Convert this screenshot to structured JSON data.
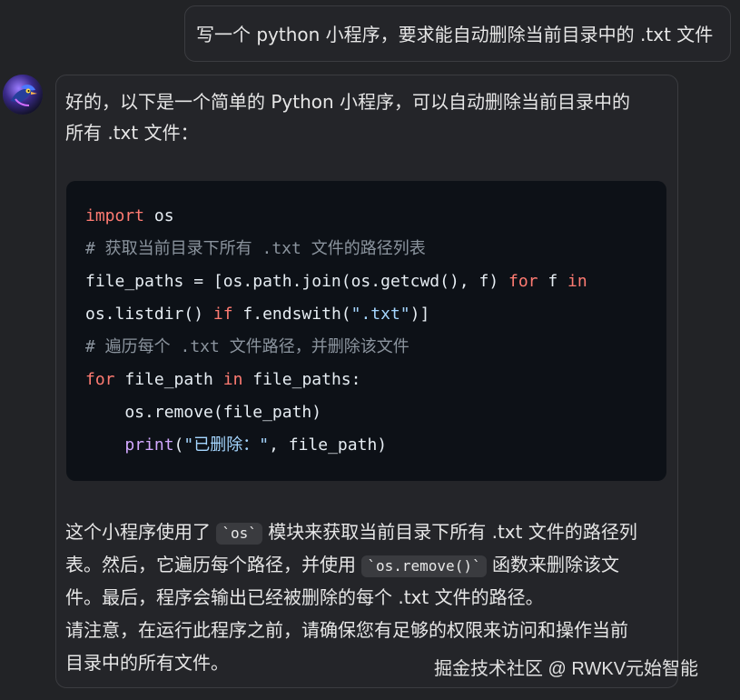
{
  "user_message": {
    "text": "写一个 python 小程序，要求能自动删除当前目录中的 .txt 文件"
  },
  "assistant_message": {
    "intro_line1": "好的，以下是一个简单的 Python 小程序，可以自动删除当前目录中的",
    "intro_line2": "所有 .txt 文件：",
    "code_lines": {
      "import_kw": "import",
      "import_rest": " os",
      "comment1": "# 获取当前目录下所有 .txt 文件的路径列表",
      "line3_prefix": "file_paths = [os.path.join(os.getcwd(), f) ",
      "line3_for": "for",
      "line3_mid": " f ",
      "line3_in": "in",
      "line4_prefix": "os.listdir() ",
      "line4_if": "if",
      "line4_mid": " f.endswith(",
      "line4_str": "\".txt\"",
      "line4_end": ")]",
      "comment2": "# 遍历每个 .txt 文件路径，并删除该文件",
      "line6_for": "for",
      "line6_mid": " file_path ",
      "line6_in": "in",
      "line6_end": " file_paths:",
      "line7": "    os.remove(file_path)",
      "line8_indent": "    ",
      "line8_print": "print",
      "line8_open": "(",
      "line8_str": "\"已删除：\"",
      "line8_end": ", file_path)"
    },
    "explain": {
      "row1_a": "这个小程序使用了 ",
      "row1_code": "`os`",
      "row1_b": " 模块来获取当前目录下所有 .txt 文件的路径列",
      "row2_a": "表。然后，它遍历每个路径，并使用 ",
      "row2_code": "`os.remove()`",
      "row2_b": " 函数来删除该文",
      "row3": "件。最后，程序会输出已经被删除的每个 .txt 文件的路径。",
      "row4": "请注意，在运行此程序之前，请确保您有足够的权限来访问和操作当前",
      "row5": "目录中的所有文件。"
    }
  },
  "watermark": "掘金技术社区 @ RWKV元始智能",
  "colors": {
    "page_bg": "#222326",
    "bubble_bg": "#242529",
    "bubble_border": "#3b3c40",
    "code_bg": "#0d1117",
    "keyword": "#ff7b72",
    "comment": "#8b949e",
    "string": "#a5d6ff",
    "function": "#d2a8ff"
  }
}
